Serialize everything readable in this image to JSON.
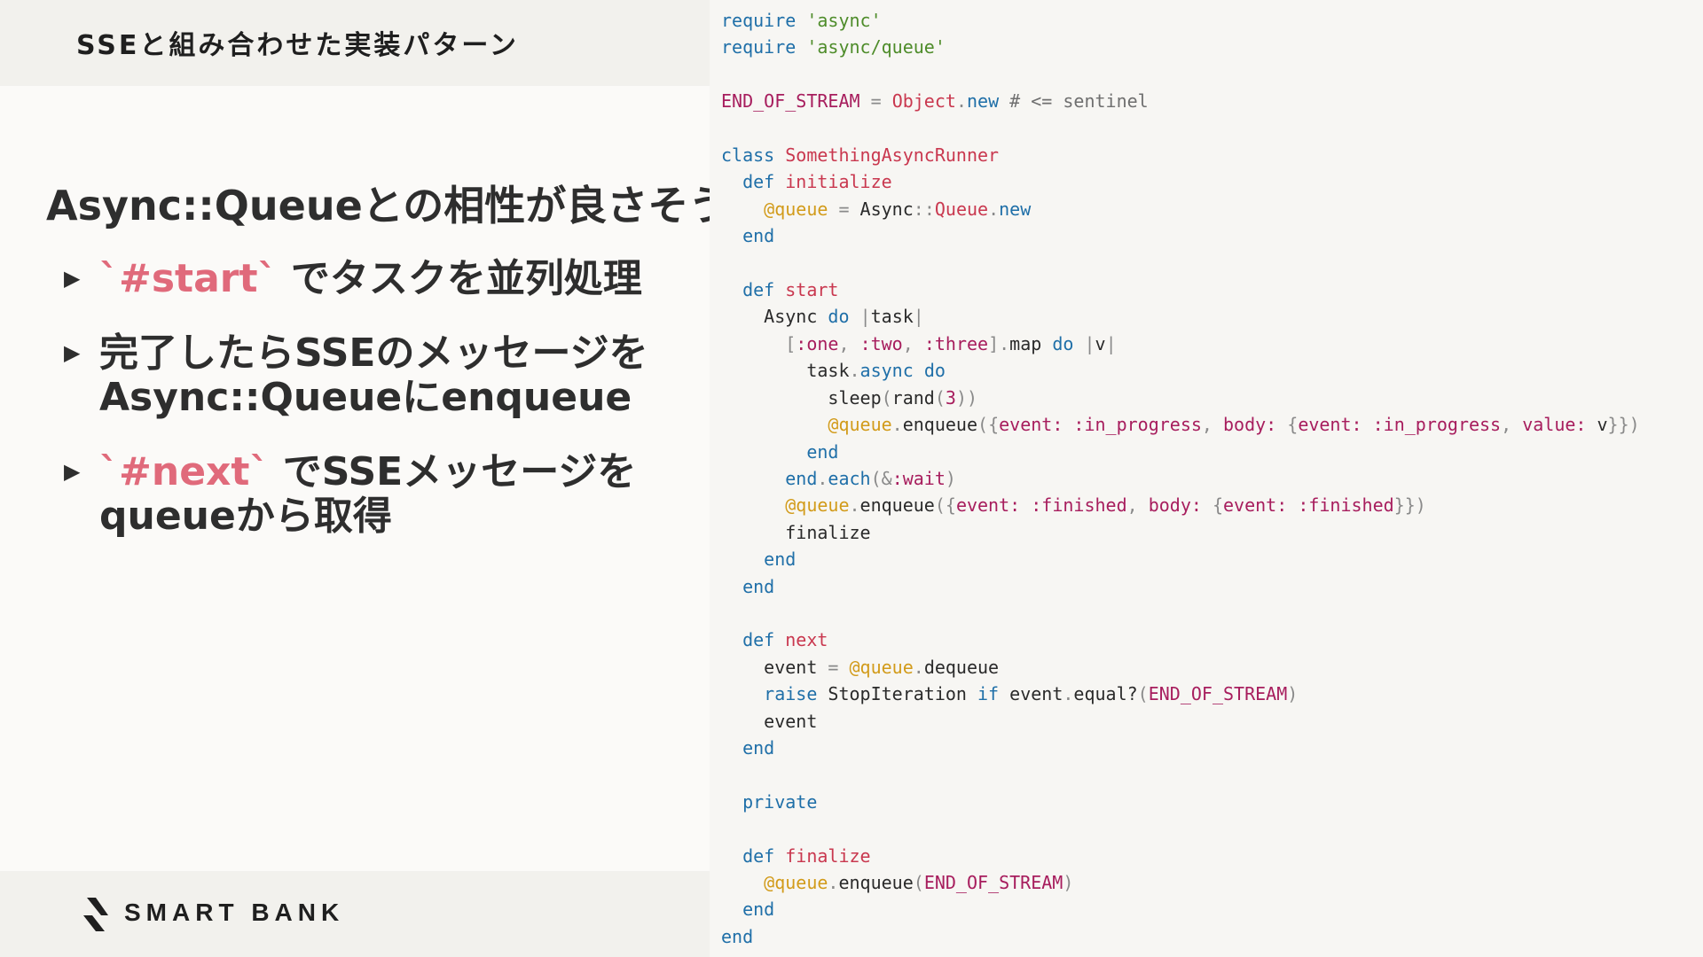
{
  "slide": {
    "title": "SSEと組み合わせた実装パターン",
    "headline": "Async::Queueとの相性が良さそう",
    "bullets": [
      {
        "code": "`#start`",
        "text": " でタスクを並列処理"
      },
      {
        "text": "完了したらSSEのメッセージを",
        "text2": "Async::Queueにenqueue"
      },
      {
        "code": "`#next`",
        "text": " でSSEメッセージを",
        "text2": "queueから取得"
      }
    ],
    "brand": "SMART BANK",
    "accent_color": "#e06a7b"
  },
  "code": {
    "language": "ruby",
    "lines": [
      "require 'async'",
      "require 'async/queue'",
      "",
      "END_OF_STREAM = Object.new # <= sentinel",
      "",
      "class SomethingAsyncRunner",
      "  def initialize",
      "    @queue = Async::Queue.new",
      "  end",
      "",
      "  def start",
      "    Async do |task|",
      "      [:one, :two, :three].map do |v|",
      "        task.async do",
      "          sleep(rand(3))",
      "          @queue.enqueue({event: :in_progress, body: {event: :in_progress, value: v}})",
      "        end",
      "      end.each(&:wait)",
      "      @queue.enqueue({event: :finished, body: {event: :finished}})",
      "      finalize",
      "    end",
      "  end",
      "",
      "  def next",
      "    event = @queue.dequeue",
      "    raise StopIteration if event.equal?(END_OF_STREAM)",
      "    event",
      "  end",
      "",
      "  private",
      "",
      "  def finalize",
      "    @queue.enqueue(END_OF_STREAM)",
      "  end",
      "end"
    ]
  }
}
